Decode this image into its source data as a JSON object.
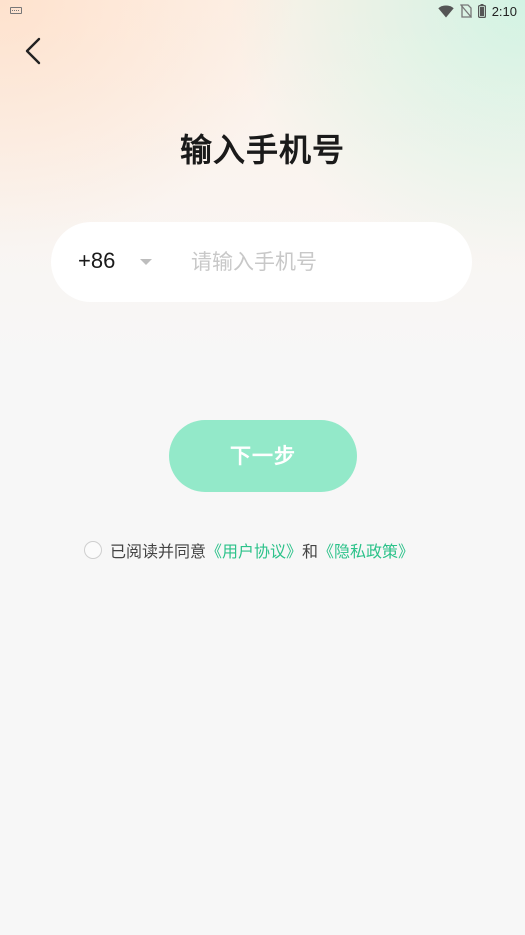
{
  "status_bar": {
    "time": "2:10"
  },
  "header": {
    "back_icon": "chevron-left-icon",
    "title": "输入手机号"
  },
  "phone_form": {
    "country_code": "+86",
    "phone_placeholder": "请输入手机号",
    "phone_value": ""
  },
  "next_button": {
    "label": "下一步"
  },
  "agreement": {
    "prefix": "已阅读并同意",
    "user_agreement_link": "《用户协议》",
    "conjunction": "和",
    "privacy_policy_link": "《隐私政策》",
    "checked": false
  },
  "colors": {
    "accent": "#2cc28a",
    "button_bg": "#93e9c9",
    "title": "#1a1a1a",
    "placeholder": "#c8c8c8"
  }
}
